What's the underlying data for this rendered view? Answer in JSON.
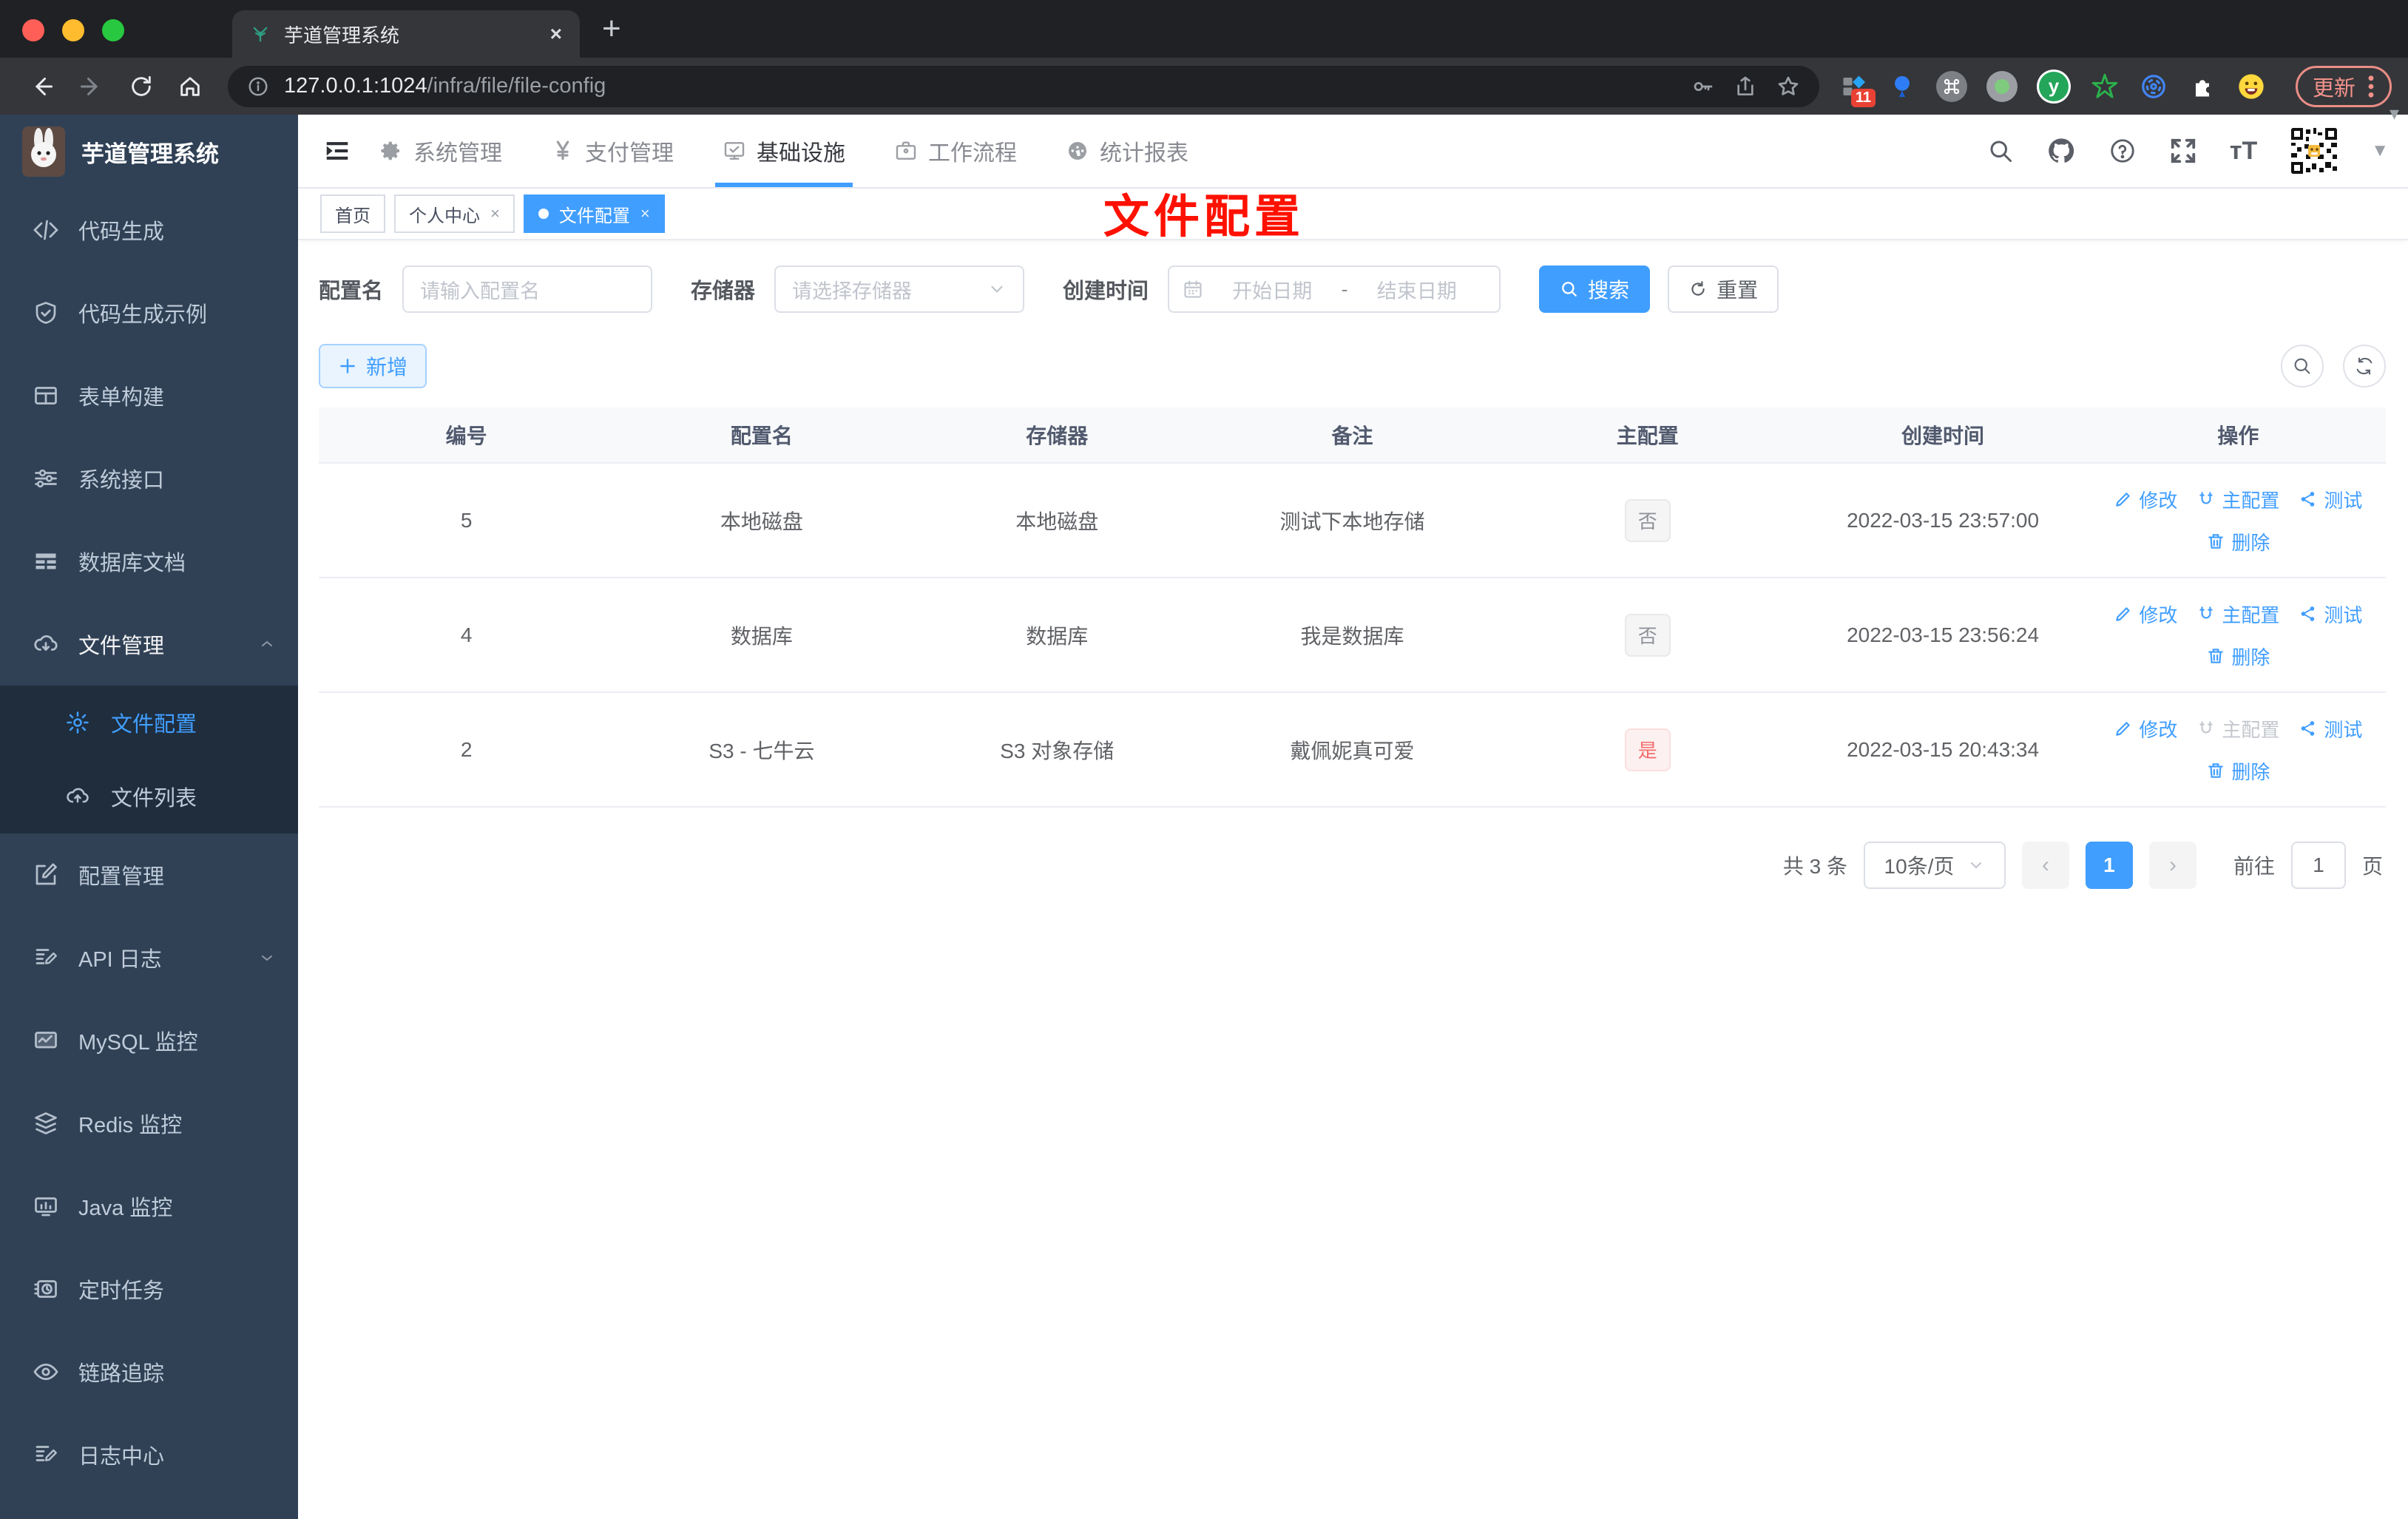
{
  "browser": {
    "tab": {
      "title": "芋道管理系统",
      "favicon": "plant-icon",
      "close": "×",
      "new_tab": "+"
    },
    "address": {
      "host": "127.0.0.1:1024",
      "path": "/infra/file/file-config"
    },
    "extensions": {
      "badge_count": "11"
    },
    "update_label": "更新"
  },
  "sidebar": {
    "title": "芋道管理系统",
    "items": [
      {
        "label": "代码生成",
        "icon": "code-icon"
      },
      {
        "label": "代码生成示例",
        "icon": "shield-check-icon"
      },
      {
        "label": "表单构建",
        "icon": "form-grid-icon"
      },
      {
        "label": "系统接口",
        "icon": "sliders-icon"
      },
      {
        "label": "数据库文档",
        "icon": "table-icon"
      },
      {
        "label": "文件管理",
        "icon": "cloud-download-icon",
        "expanded": true,
        "children": [
          {
            "label": "文件配置",
            "icon": "gear-icon",
            "active": true
          },
          {
            "label": "文件列表",
            "icon": "cloud-upload-icon"
          }
        ]
      },
      {
        "label": "配置管理",
        "icon": "edit-square-icon"
      },
      {
        "label": "API 日志",
        "icon": "log-edit-icon",
        "collapsed": true
      },
      {
        "label": "MySQL 监控",
        "icon": "chart-monitor-icon"
      },
      {
        "label": "Redis 监控",
        "icon": "layers-icon"
      },
      {
        "label": "Java 监控",
        "icon": "monitor-bars-icon"
      },
      {
        "label": "定时任务",
        "icon": "timer-icon"
      },
      {
        "label": "链路追踪",
        "icon": "eye-icon"
      },
      {
        "label": "日志中心",
        "icon": "log-edit-icon"
      }
    ]
  },
  "topnav": {
    "items": [
      {
        "label": "系统管理",
        "icon": "gear-icon"
      },
      {
        "label": "支付管理",
        "icon": "yen-icon"
      },
      {
        "label": "基础设施",
        "icon": "monitor-check-icon",
        "active": true
      },
      {
        "label": "工作流程",
        "icon": "briefcase-icon"
      },
      {
        "label": "统计报表",
        "icon": "dashboard-icon"
      }
    ],
    "right_icons": [
      "search-icon",
      "github-icon",
      "help-icon",
      "fullscreen-icon",
      "font-size-icon",
      "qr-avatar",
      "chevron-down-icon"
    ]
  },
  "tags_view": [
    {
      "label": "首页"
    },
    {
      "label": "个人中心",
      "close": "×"
    },
    {
      "label": "文件配置",
      "close": "×",
      "active": true
    }
  ],
  "watermark": "文件配置",
  "filters": {
    "name_label": "配置名",
    "name_placeholder": "请输入配置名",
    "storage_label": "存储器",
    "storage_placeholder": "请选择存储器",
    "time_label": "创建时间",
    "time_start_placeholder": "开始日期",
    "time_separator": "-",
    "time_end_placeholder": "结束日期",
    "search_label": "搜索",
    "reset_label": "重置"
  },
  "toolbar": {
    "add_label": "新增"
  },
  "table": {
    "headers": [
      "编号",
      "配置名",
      "存储器",
      "备注",
      "主配置",
      "创建时间",
      "操作"
    ],
    "actions": {
      "edit": "修改",
      "master": "主配置",
      "test": "测试",
      "delete": "删除"
    },
    "rows": [
      {
        "id": "5",
        "name": "本地磁盘",
        "storage": "本地磁盘",
        "remark": "测试下本地存储",
        "master": "否",
        "master_type": "info",
        "created": "2022-03-15 23:57:00"
      },
      {
        "id": "4",
        "name": "数据库",
        "storage": "数据库",
        "remark": "我是数据库",
        "master": "否",
        "master_type": "info",
        "created": "2022-03-15 23:56:24"
      },
      {
        "id": "2",
        "name": "S3 - 七牛云",
        "storage": "S3 对象存储",
        "remark": "戴佩妮真可爱",
        "master": "是",
        "master_type": "danger",
        "created": "2022-03-15 20:43:34"
      }
    ]
  },
  "pagination": {
    "total": "共 3 条",
    "page_size": "10条/页",
    "prev": "‹",
    "next": "›",
    "current": "1",
    "goto_label": "前往",
    "goto_value": "1",
    "page_unit": "页"
  },
  "colors": {
    "accent": "#409eff",
    "danger": "#f56c6c",
    "sidebar": "#304156",
    "watermark": "#fe1100"
  }
}
